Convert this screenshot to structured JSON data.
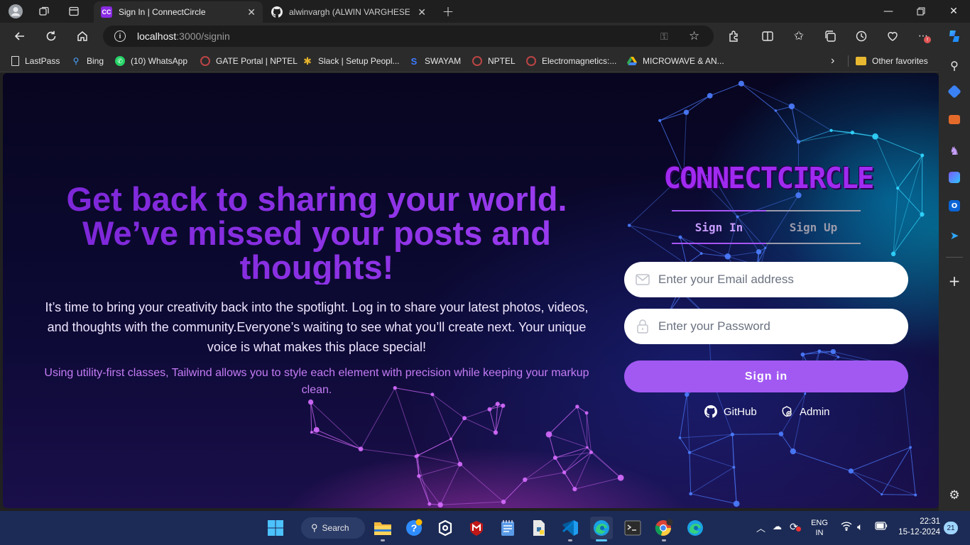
{
  "browser": {
    "tabs": [
      {
        "title": "Sign In | ConnectCircle",
        "favicon_text": "CC",
        "active": true
      },
      {
        "title": "alwinvargh (ALWIN VARGHESE) ·",
        "active": false
      }
    ],
    "address": {
      "host": "localhost",
      "path": ":3000/signin"
    },
    "bookmarks": [
      {
        "label": "LastPass"
      },
      {
        "label": "Bing"
      },
      {
        "label": "(10) WhatsApp"
      },
      {
        "label": "GATE Portal | NPTEL"
      },
      {
        "label": "Slack | Setup Peopl..."
      },
      {
        "label": "SWAYAM"
      },
      {
        "label": "NPTEL"
      },
      {
        "label": "Electromagnetics:..."
      },
      {
        "label": "MICROWAVE & AN..."
      }
    ],
    "other_favorites": "Other favorites"
  },
  "page": {
    "hero": {
      "title": "Get back to sharing your world. We’ve missed your posts and thoughts!",
      "description": "It’s time to bring your creativity back into the spotlight. Log in to share your latest photos, videos, and thoughts with the community.Everyone’s waiting to see what you’ll create next. Your unique voice is what makes this place special!",
      "note": "Using utility-first classes, Tailwind allows you to style each element with precision while keeping your markup clean."
    },
    "auth": {
      "logo": "CONNECTCIRCLE",
      "tab_signin": "Sign In",
      "tab_signup": "Sign Up",
      "email_placeholder": "Enter your Email address",
      "password_placeholder": "Enter your Password",
      "signin_button": "Sign in",
      "github_label": "GitHub",
      "admin_label": "Admin"
    }
  },
  "taskbar": {
    "search_label": "Search",
    "language_line1": "ENG",
    "language_line2": "IN",
    "time": "22:31",
    "date": "15-12-2024",
    "notification_count": "21"
  },
  "colors": {
    "accent_purple": "#a259f2",
    "title_purple": "#8a2be2",
    "taskbar": "#1c2b55"
  }
}
